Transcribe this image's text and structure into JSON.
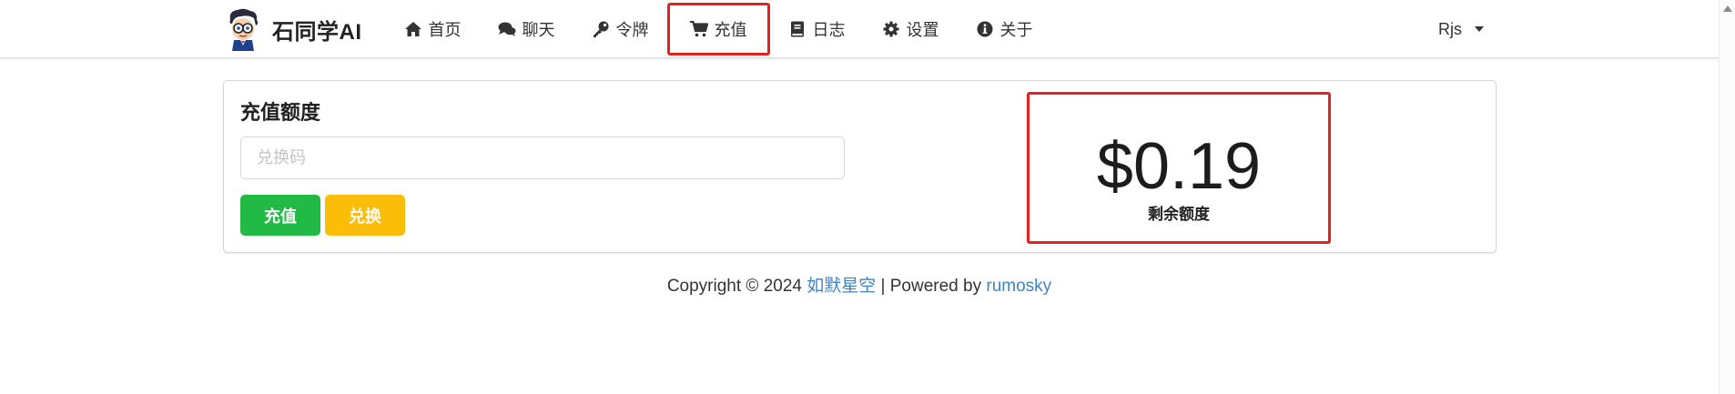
{
  "header": {
    "brand": "石同学AI",
    "nav": [
      {
        "label": "首页",
        "icon": "home-icon"
      },
      {
        "label": "聊天",
        "icon": "comments-icon"
      },
      {
        "label": "令牌",
        "icon": "key-icon"
      },
      {
        "label": "充值",
        "icon": "cart-icon",
        "active": true
      },
      {
        "label": "日志",
        "icon": "book-icon"
      },
      {
        "label": "设置",
        "icon": "gear-icon"
      },
      {
        "label": "关于",
        "icon": "info-icon"
      }
    ],
    "user": "Rjs"
  },
  "topup": {
    "title": "充值额度",
    "input_placeholder": "兑换码",
    "input_value": "",
    "topup_button": "充值",
    "redeem_button": "兑换",
    "balance": "$0.19",
    "balance_label": "剩余额度"
  },
  "footer": {
    "prefix": "Copyright © 2024 ",
    "link1": "如默星空",
    "middle": " | Powered by ",
    "link2": "rumosky"
  },
  "colors": {
    "highlight": "#e52222",
    "topup_button": "#21ba45",
    "redeem_button": "#fbbd08",
    "link": "#4183c4"
  }
}
